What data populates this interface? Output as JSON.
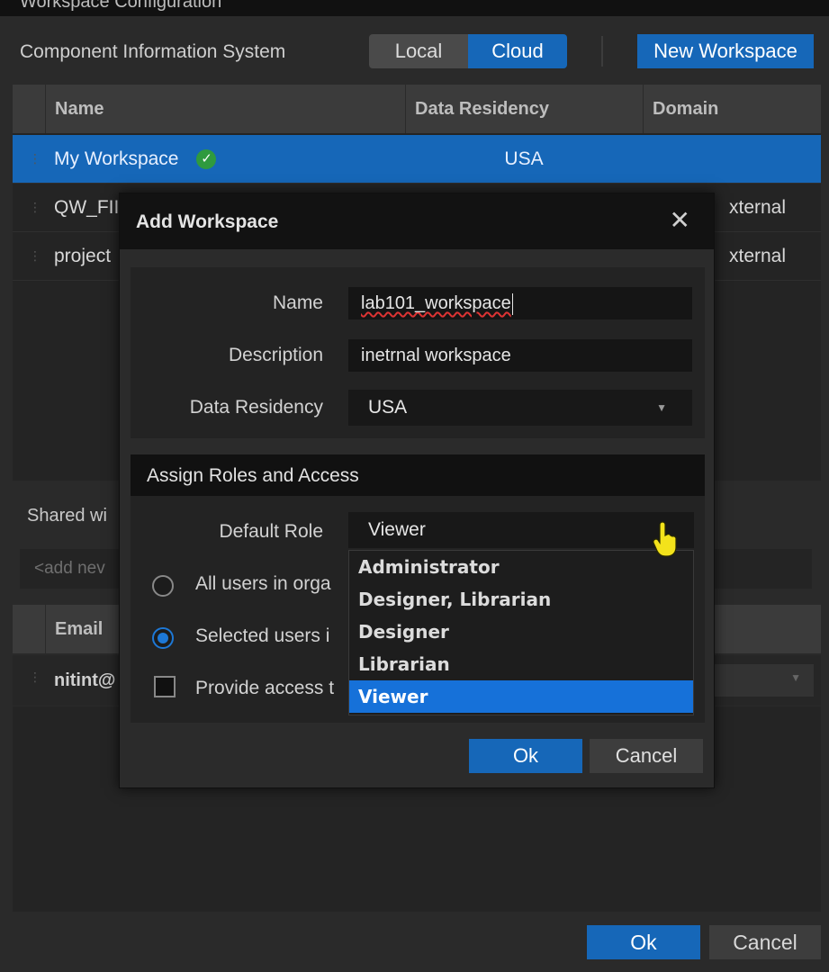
{
  "window": {
    "title": "Workspace Configuration",
    "section_label": "Component Information System",
    "toggle": {
      "local": "Local",
      "cloud": "Cloud",
      "selected": "Cloud"
    },
    "new_workspace_label": "New Workspace"
  },
  "table": {
    "columns": [
      "Name",
      "Data Residency",
      "Domain"
    ],
    "rows": [
      {
        "name": "My Workspace",
        "residency": "USA",
        "domain": "",
        "selected": true,
        "default": true
      },
      {
        "name": "QW_FII",
        "residency": "",
        "domain": "xternal"
      },
      {
        "name": "project",
        "residency": "",
        "domain": "xternal"
      }
    ]
  },
  "shared": {
    "label": "Shared wi",
    "add_placeholder": "<add nev",
    "email_header": "Email",
    "email_rows": [
      "nitint@"
    ]
  },
  "footer": {
    "ok": "Ok",
    "cancel": "Cancel"
  },
  "dialog": {
    "title": "Add Workspace",
    "close_glyph": "✕",
    "name_label": "Name",
    "name_value": "lab101_workspace",
    "description_label": "Description",
    "description_value": "inetrnal workspace",
    "residency_label": "Data Residency",
    "residency_value": "USA",
    "roles_heading": "Assign Roles and Access",
    "default_role_label": "Default Role",
    "default_role_value": "Viewer",
    "role_options": [
      "Administrator",
      "Designer, Librarian",
      "Designer",
      "Librarian",
      "Viewer"
    ],
    "role_selected": "Viewer",
    "option_all_users": "All users in orga",
    "option_selected_users": "Selected users i",
    "option_provide_access": "Provide access t",
    "ok": "Ok",
    "cancel": "Cancel"
  },
  "colors": {
    "accent": "#1667b8",
    "highlight": "#1671d9",
    "success": "#2f9a3e"
  }
}
